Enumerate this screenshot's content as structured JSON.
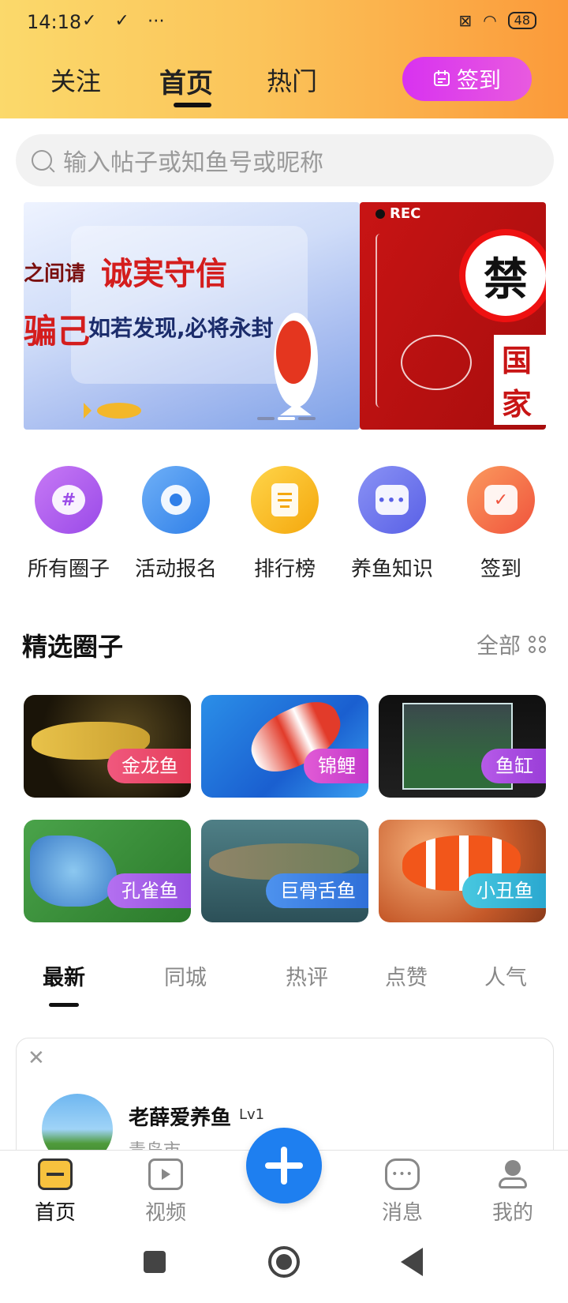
{
  "status": {
    "time": "14:18",
    "icons_left": "✓ ✓ ⋯",
    "battery": "48"
  },
  "top_tabs": [
    {
      "label": "关注",
      "active": false
    },
    {
      "label": "首页",
      "active": true
    },
    {
      "label": "热门",
      "active": false
    }
  ],
  "checkin_button": {
    "label": "签到"
  },
  "search": {
    "placeholder": "输入帖子或知鱼号或昵称"
  },
  "banners": [
    {
      "line1": "之间请",
      "line2": "诚実守信",
      "line3": "骗己",
      "line4": "如若发现,必将永封"
    },
    {
      "rec": "REC",
      "ban": "禁",
      "text": "国家"
    }
  ],
  "quick_entries": [
    {
      "label": "所有圈子",
      "icon": "hashtag-chat-icon",
      "color": "#b35cf0"
    },
    {
      "label": "活动报名",
      "icon": "webcam-icon",
      "color": "#3b8ff0"
    },
    {
      "label": "排行榜",
      "icon": "document-icon",
      "color": "#f7b71a"
    },
    {
      "label": "养鱼知识",
      "icon": "message-icon",
      "color": "#6b73ee"
    },
    {
      "label": "签到",
      "icon": "calendar-check-icon",
      "color": "#f46b45"
    }
  ],
  "featured": {
    "title": "精选圈子",
    "all_label": "全部"
  },
  "circles": [
    {
      "label": "金龙鱼",
      "tag_color": "#e8455e"
    },
    {
      "label": "锦鲤",
      "tag_color": "#d23ec9"
    },
    {
      "label": "鱼缸",
      "tag_color": "#a749e0"
    },
    {
      "label": "孔雀鱼",
      "tag_color": "#a45de8"
    },
    {
      "label": "巨骨舌鱼",
      "tag_color": "#3f83e8"
    },
    {
      "label": "小丑鱼",
      "tag_color": "#35b9d8"
    }
  ],
  "feed_tabs": [
    {
      "label": "最新",
      "active": true
    },
    {
      "label": "同城",
      "active": false
    },
    {
      "label": "热评",
      "active": false
    },
    {
      "label": "点赞",
      "active": false
    },
    {
      "label": "人气",
      "active": false
    }
  ],
  "post": {
    "username": "老薛爱养鱼",
    "level": "Lv1",
    "city": "青岛市"
  },
  "bottom_nav": [
    {
      "label": "首页",
      "icon": "home-icon",
      "active": true
    },
    {
      "label": "视频",
      "icon": "video-icon",
      "active": false
    },
    {
      "label": "消息",
      "icon": "message-icon",
      "active": false
    },
    {
      "label": "我的",
      "icon": "profile-icon",
      "active": false
    }
  ]
}
